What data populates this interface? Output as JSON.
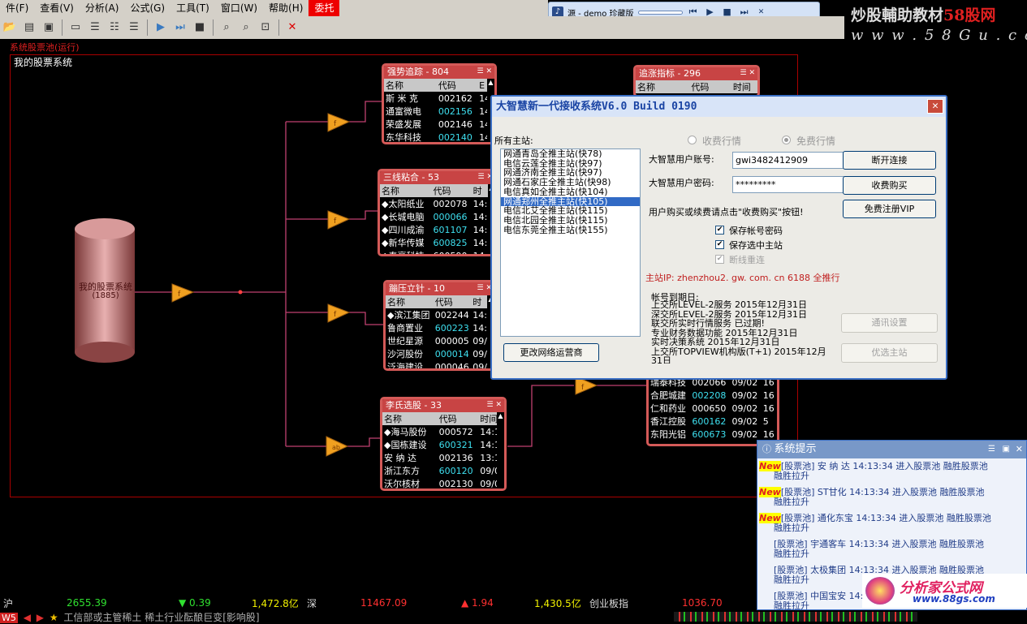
{
  "menu": [
    "件(F)",
    "查看(V)",
    "分析(A)",
    "公式(G)",
    "工具(T)",
    "窗口(W)",
    "帮助(H)",
    "委托"
  ],
  "player": {
    "source": "源 - demo 珍藏版"
  },
  "watermark": {
    "line1_a": "炒股輔助教材",
    "line1_b": "58股网",
    "line2": "w w w . 5 8 G u . c o m"
  },
  "system_label": "系统股票池(运行)",
  "panel_title": "我的股票系统",
  "db": {
    "name": "我的股票系统",
    "count": "(1885)"
  },
  "boxes": [
    {
      "title": "强势追踪 - 804",
      "cols": [
        "名称",
        "代码",
        "E"
      ],
      "rows": [
        [
          "斯 米 克",
          "002162",
          "14"
        ],
        [
          "通富微电",
          "002156",
          "14"
        ],
        [
          "荣盛发展",
          "002146",
          "14"
        ],
        [
          "东华科技",
          "002140",
          "14"
        ]
      ]
    },
    {
      "title": "三线粘合 - 53",
      "cols": [
        "名称",
        "代码",
        "时"
      ],
      "rows": [
        [
          "◆太阳纸业",
          "002078",
          "14:1"
        ],
        [
          "◆长城电脑",
          "000066",
          "14:1"
        ],
        [
          "◆四川成渝",
          "601107",
          "14:1"
        ],
        [
          "◆新华传媒",
          "600825",
          "14:1"
        ],
        [
          "◆泰豪科技",
          "600590",
          "14:1"
        ]
      ]
    },
    {
      "title": "蹦压立针 - 10",
      "cols": [
        "名称",
        "代码",
        "时"
      ],
      "rows": [
        [
          "◆滨江集团",
          "002244",
          "14:1"
        ],
        [
          "鲁商置业",
          "600223",
          "14:1"
        ],
        [
          "世纪星源",
          "000005",
          "09/0"
        ],
        [
          "沙河股份",
          "000014",
          "09/0"
        ],
        [
          "泛海建设",
          "000046",
          "09/0"
        ]
      ]
    },
    {
      "title": "李氏选股 - 33",
      "cols": [
        "名称",
        "代码",
        "时间"
      ],
      "rows": [
        [
          "◆海马股份",
          "000572",
          "14:1"
        ],
        [
          "◆国栋建设",
          "600321",
          "14:1"
        ],
        [
          "安 纳 达",
          "002136",
          "13:1"
        ],
        [
          "浙江东方",
          "600120",
          "09/0"
        ],
        [
          "沃尔核材",
          "002130",
          "09/0"
        ]
      ]
    },
    {
      "title": "追涨指标 - 296",
      "cols": [
        "名称",
        "代码",
        "时间"
      ],
      "rows": []
    },
    {
      "title": "",
      "cols": [],
      "rows": [
        [
          "瑞泰科技",
          "002066",
          "09/02",
          "16"
        ],
        [
          "合肥城建",
          "002208",
          "09/02",
          "16"
        ],
        [
          "仁和药业",
          "000650",
          "09/02",
          "16"
        ],
        [
          "香江控股",
          "600162",
          "09/02",
          "5"
        ],
        [
          "东阳光铝",
          "600673",
          "09/02",
          "16"
        ]
      ]
    }
  ],
  "dialog": {
    "title": "大智慧新一代接收系统V6.0 Build 0190",
    "hosts_label": "所有主站:",
    "hosts": [
      "网通青岛全推主站(快78)",
      "电信云莲全推主站(快97)",
      "网通济南全推主站(快97)",
      "网通石家庄全推主站(快98)",
      "电信真如全推主站(快104)",
      "网通郑州全推主站(快105)",
      "电信北艾全推主站(快115)",
      "电信北园全推主站(快115)",
      "电信东莞全推主站(快155)"
    ],
    "radio_paid": "收费行情",
    "radio_free": "免费行情",
    "account_label": "大智慧用户账号:",
    "account_value": "gwi3482412909",
    "password_label": "大智慧用户密码:",
    "password_value": "*********",
    "buy_hint": "用户购买或续费请点击\"收费购买\"按钮!",
    "chk_save_pwd": "保存帐号密码",
    "chk_save_host": "保存选中主站",
    "chk_reconnect": "断线重连",
    "host_ip": "主站IP: zhenzhou2. gw. com. cn 6188 全推行",
    "expiry_title": "帐号到期日:",
    "expiry": [
      "上交所LEVEL-2服务  2015年12月31日",
      "深交所LEVEL-2服务  2015年12月31日",
      "  联交所实时行情服务  已过期!",
      "专业财务数据功能  2015年12月31日",
      "实时决策系统  2015年12月31日",
      "上交所TOPVIEW机构版(T+1) 2015年12月",
      "31日"
    ],
    "btn_disconnect": "断开连接",
    "btn_buy": "收费购买",
    "btn_vip": "免费注册VIP",
    "btn_settings": "通讯设置",
    "btn_best": "优选主站",
    "btn_change_isp": "更改网络运营商"
  },
  "notice": {
    "title": "系统提示",
    "items": [
      {
        "new": true,
        "l1": "[股票池] 安 纳 达  14:13:34 进入股票池 融胜股票池",
        "l2": "融胜拉升"
      },
      {
        "new": true,
        "l1": "[股票池] ST甘化  14:13:34 进入股票池 融胜股票池",
        "l2": "融胜拉升"
      },
      {
        "new": true,
        "l1": "[股票池] 通化东宝  14:13:34 进入股票池 融胜股票池",
        "l2": "融胜拉升"
      },
      {
        "new": false,
        "l1": "[股票池] 宇通客车  14:13:34 进入股票池 融胜股票池",
        "l2": "融胜拉升"
      },
      {
        "new": false,
        "l1": "[股票池] 太极集团  14:13:34 进入股票池 融胜股票池",
        "l2": "融胜拉升"
      },
      {
        "new": false,
        "l1": "[股票池] 中国宝安  14:13:34 进入股票池 融胜股票池",
        "l2": "融胜拉升"
      }
    ]
  },
  "logo2": {
    "name": "分析家公式网",
    "url": "www.88gs.com"
  },
  "status": {
    "sh_label": "沪",
    "sh_value": "2655.39",
    "sh_change": "▼ 0.39",
    "sh_amount": "1,472.8亿",
    "sz_label": "深",
    "sz_value": "11467.09",
    "sz_change": "▲ 1.94",
    "sz_amount": "1,430.5亿",
    "cy_label": "创业板指",
    "cy_value": "1036.70"
  },
  "ticker": {
    "badge": "W5",
    "text": "工信部或主管稀土 稀土行业酝酿巨变[影响股]"
  },
  "colors": {
    "up": "#ff3030",
    "down": "#30e030",
    "box_border": "#d45a58"
  }
}
